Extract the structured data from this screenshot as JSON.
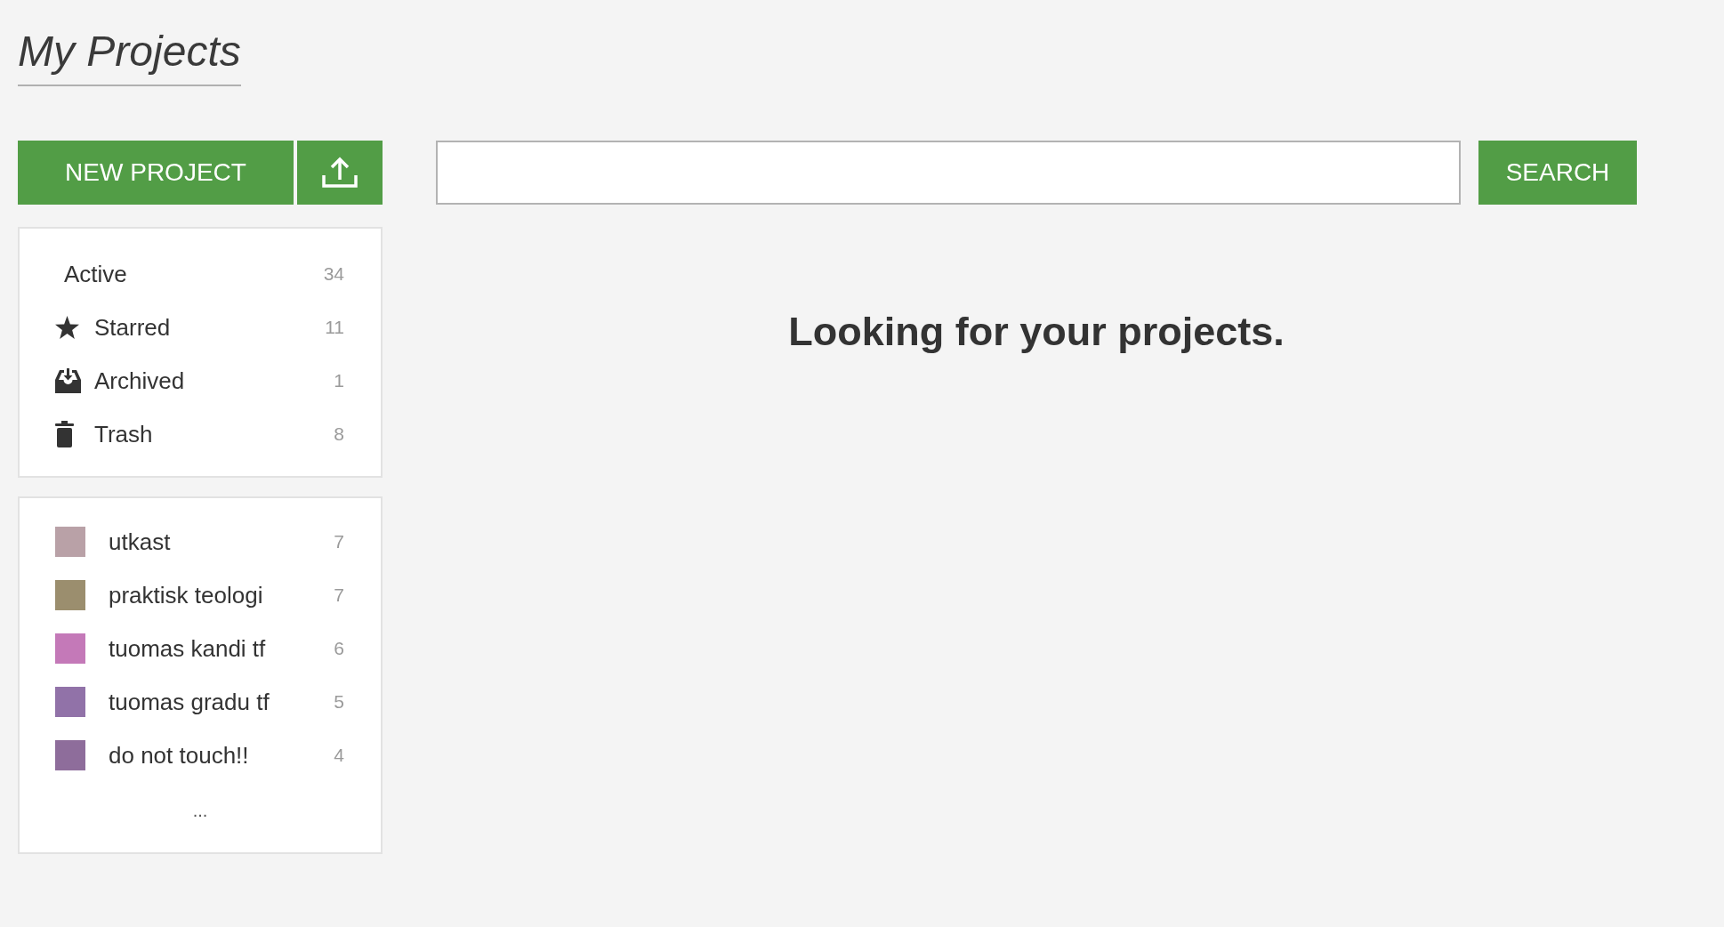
{
  "page": {
    "title": "My Projects"
  },
  "actions": {
    "new_project": "NEW PROJECT"
  },
  "search": {
    "button": "SEARCH"
  },
  "filters": [
    {
      "label": "Active",
      "count": "34"
    },
    {
      "label": "Starred",
      "count": "11"
    },
    {
      "label": "Archived",
      "count": "1"
    },
    {
      "label": "Trash",
      "count": "8"
    }
  ],
  "tags": [
    {
      "name": "utkast",
      "count": "7",
      "color": "#b9a1a7"
    },
    {
      "name": "praktisk teologi",
      "count": "7",
      "color": "#9b8e6e"
    },
    {
      "name": "tuomas kandi tf",
      "count": "6",
      "color": "#c479b8"
    },
    {
      "name": "tuomas gradu tf",
      "count": "5",
      "color": "#9172a8"
    },
    {
      "name": "do not touch!!",
      "count": "4",
      "color": "#8e6d9b"
    }
  ],
  "tags_more": "...",
  "status_message": "Looking for your projects."
}
